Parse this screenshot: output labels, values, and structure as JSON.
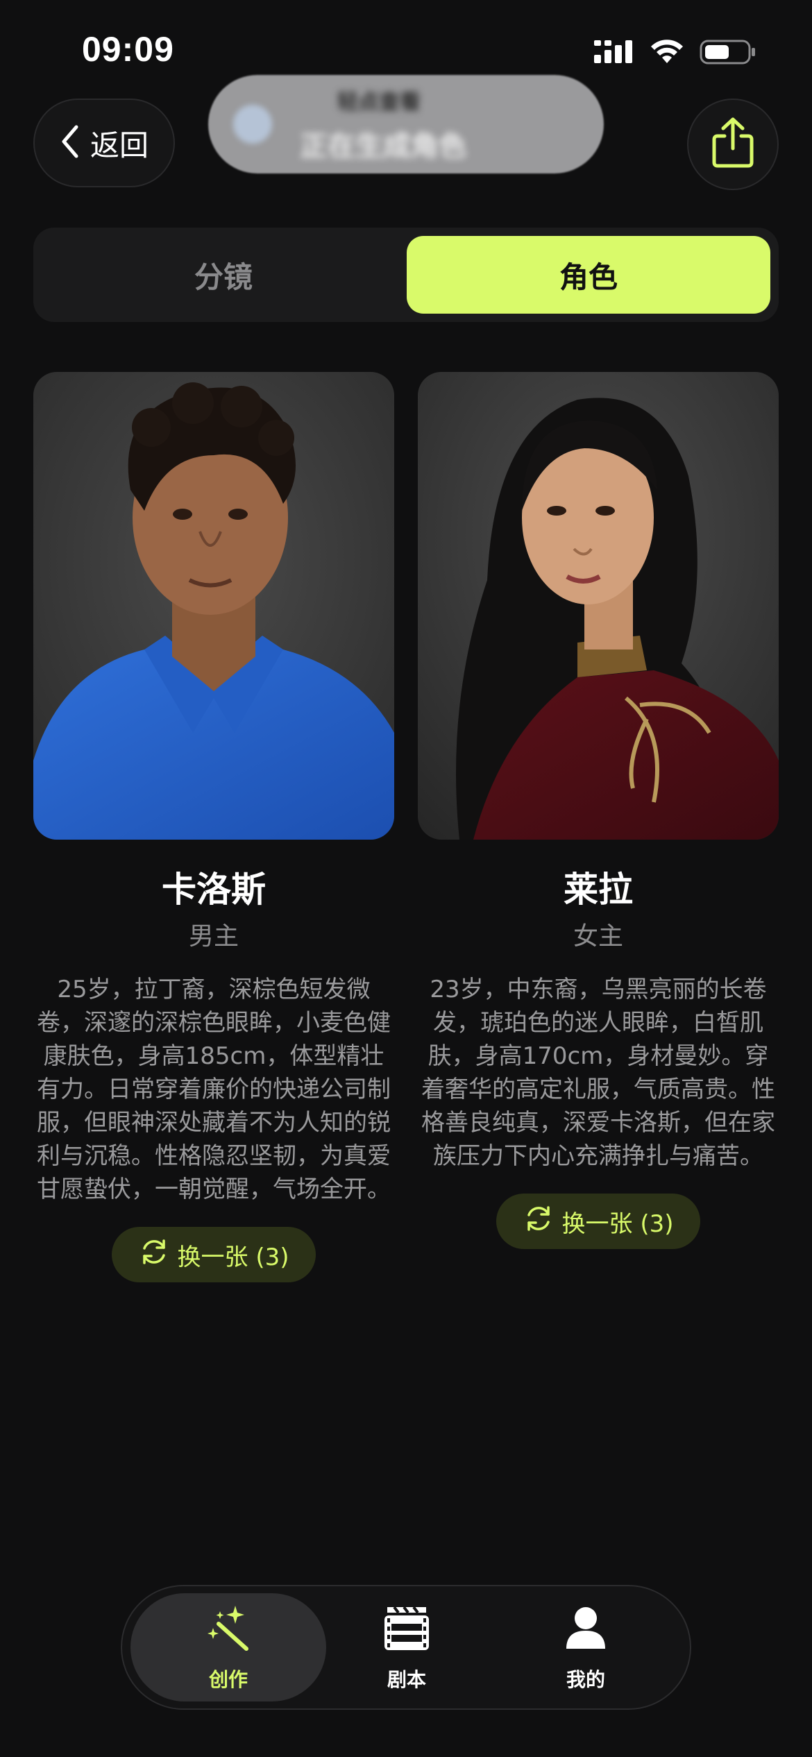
{
  "status_bar": {
    "time": "09:09"
  },
  "header": {
    "back_label": "返回",
    "toast_title": "轻点查看",
    "toast_subtitle": "正在生成角色",
    "share_icon": "share-icon"
  },
  "tabs": {
    "storyboard_label": "分镜",
    "characters_label": "角色",
    "active": "角色"
  },
  "characters": [
    {
      "name": "卡洛斯",
      "role": "男主",
      "description": "25岁，拉丁裔，深棕色短发微卷，深邃的深棕色眼眸，小麦色健康肤色，身高185cm，体型精壮有力。日常穿着廉价的快递公司制服，但眼神深处藏着不为人知的锐利与沉稳。性格隐忍坚韧，为真爱甘愿蛰伏，一朝觉醒，气场全开。",
      "swap_label": "换一张 (3)"
    },
    {
      "name": "莱拉",
      "role": "女主",
      "description": "23岁，中东裔，乌黑亮丽的长卷发，琥珀色的迷人眼眸，白皙肌肤，身高170cm，身材曼妙。穿着奢华的高定礼服，气质高贵。性格善良纯真，深爱卡洛斯，但在家族压力下内心充满挣扎与痛苦。",
      "swap_label": "换一张 (3)"
    }
  ],
  "tabbar": {
    "items": [
      {
        "label": "创作",
        "icon": "magic-wand-icon",
        "active": true
      },
      {
        "label": "剧本",
        "icon": "film-icon",
        "active": false
      },
      {
        "label": "我的",
        "icon": "user-icon",
        "active": false
      }
    ]
  },
  "colors": {
    "background": "#0f0f10",
    "accent": "#d9fa6a",
    "accent_dark": "#2b3117",
    "text_secondary": "#9a9a9c"
  }
}
